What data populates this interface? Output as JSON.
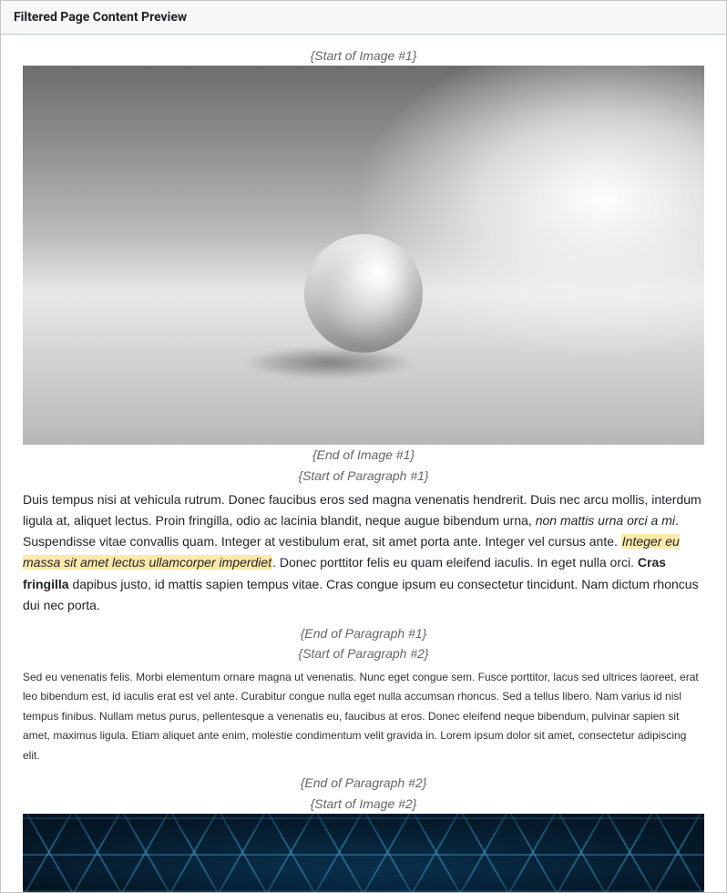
{
  "panel": {
    "title": "Filtered Page Content Preview"
  },
  "markers": {
    "img1_start": "{Start of Image #1}",
    "img1_end": "{End of Image #1}",
    "para1_start": "{Start of Paragraph #1}",
    "para1_end": "{End of Paragraph #1}",
    "para2_start": "{Start of Paragraph #2}",
    "para2_end": "{End of Paragraph #2}",
    "img2_start": "{Start of Image #2}"
  },
  "paragraph1": {
    "seg1": "Duis tempus nisi at vehicula rutrum. Donec faucibus eros sed magna venenatis hendrerit. Duis nec arcu mollis, interdum ligula at, aliquet lectus. Proin fringilla, odio ac lacinia blandit, neque augue bibendum urna, ",
    "em1": "non mattis urna orci a mi",
    "seg2": ". Suspendisse vitae convallis quam. Integer at vestibulum erat, sit amet porta ante. Integer vel cursus ante. ",
    "hl1": "Integer eu massa sit amet lectus ullamcorper imperdiet",
    "seg3": ". Donec porttitor felis eu quam eleifend iaculis. In eget nulla orci. ",
    "bold1": "Cras fringilla",
    "seg4": " dapibus justo, id mattis sapien tempus vitae. Cras congue ipsum eu consectetur tincidunt. Nam dictum rhoncus dui nec porta."
  },
  "paragraph2": {
    "text": "Sed eu venenatis felis. Morbi elementum ornare magna ut venenatis. Nunc eget congue sem. Fusce porttitor, lacus sed ultrices laoreet, erat leo bibendum est, id iaculis erat est vel ante. Curabitur congue nulla eget nulla accumsan rhoncus. Sed a tellus libero. Nam varius id nisl tempus finibus. Nullam metus purus, pellentesque a venenatis eu, faucibus at eros. Donec eleifend neque bibendum, pulvinar sapien sit amet, maximus ligula. Etiam aliquet ante enim, molestie condimentum velit gravida in. Lorem ipsum dolor sit amet, consectetur adipiscing elit."
  }
}
